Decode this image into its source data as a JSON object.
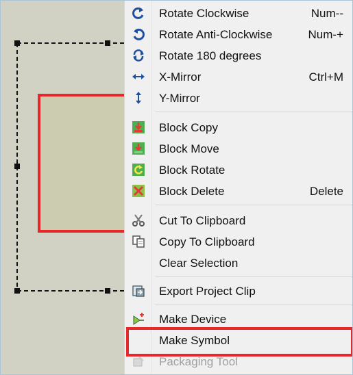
{
  "canvas": {
    "background": "#d2d2c4",
    "shape_fill": "#ccccb0",
    "shape_border": "#e8272b"
  },
  "highlight_color": "#e8272b",
  "menu": {
    "items": [
      {
        "label": "Rotate Clockwise",
        "shortcut": "Num--",
        "icon": "rotate-clockwise-icon",
        "disabled": false
      },
      {
        "label": "Rotate Anti-Clockwise",
        "shortcut": "Num-+",
        "icon": "rotate-anticlockwise-icon",
        "disabled": false
      },
      {
        "label": "Rotate 180 degrees",
        "shortcut": "",
        "icon": "rotate-180-icon",
        "disabled": false
      },
      {
        "label": "X-Mirror",
        "shortcut": "Ctrl+M",
        "icon": "x-mirror-icon",
        "disabled": false
      },
      {
        "label": "Y-Mirror",
        "shortcut": "",
        "icon": "y-mirror-icon",
        "disabled": false
      },
      {
        "label": "Block Copy",
        "shortcut": "",
        "icon": "block-copy-icon",
        "disabled": false
      },
      {
        "label": "Block Move",
        "shortcut": "",
        "icon": "block-move-icon",
        "disabled": false
      },
      {
        "label": "Block Rotate",
        "shortcut": "",
        "icon": "block-rotate-icon",
        "disabled": false
      },
      {
        "label": "Block Delete",
        "shortcut": "Delete",
        "icon": "block-delete-icon",
        "disabled": false
      },
      {
        "label": "Cut To Clipboard",
        "shortcut": "",
        "icon": "scissors-icon",
        "disabled": false
      },
      {
        "label": "Copy To Clipboard",
        "shortcut": "",
        "icon": "copy-icon",
        "disabled": false
      },
      {
        "label": "Clear Selection",
        "shortcut": "",
        "icon": "",
        "disabled": false
      },
      {
        "label": "Export Project Clip",
        "shortcut": "",
        "icon": "export-clip-icon",
        "disabled": false
      },
      {
        "label": "Make Device",
        "shortcut": "",
        "icon": "make-device-icon",
        "disabled": false
      },
      {
        "label": "Make Symbol",
        "shortcut": "",
        "icon": "",
        "disabled": false
      },
      {
        "label": "Packaging Tool",
        "shortcut": "",
        "icon": "packaging-tool-icon",
        "disabled": true
      }
    ]
  }
}
